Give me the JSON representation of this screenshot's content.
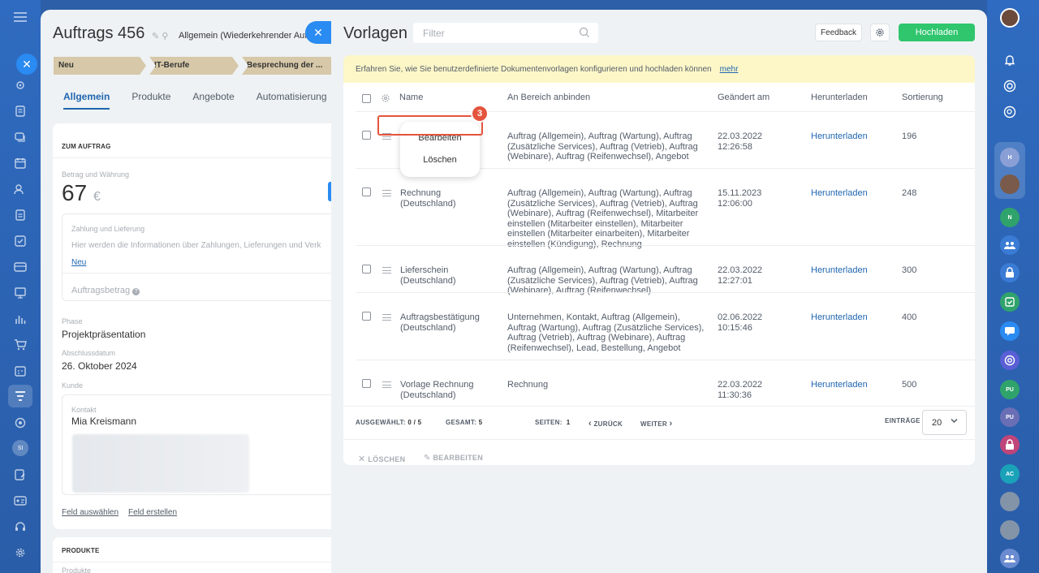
{
  "deal": {
    "title": "Auftrags 456",
    "subtitle": "Allgemein (Wiederkehrender Auftr",
    "stages": [
      "Neu",
      "IT-Berufe",
      "Besprechung der ..."
    ],
    "tabs": [
      "Allgemein",
      "Produkte",
      "Angebote",
      "Automatisierung"
    ],
    "section_title": "ZUM AUFTRAG",
    "amount_label": "Betrag und Währung",
    "amount_value": "67",
    "currency": "€",
    "payment_title": "Zahlung und Lieferung",
    "payment_text": "Hier werden die Informationen über Zahlungen, Lieferungen und Verk",
    "payment_link": "Neu",
    "order_amount_label": "Auftragsbetrag",
    "phase_label": "Phase",
    "phase_value": "Projektpräsentation",
    "close_date_label": "Abschlussdatum",
    "close_date_value": "26. Oktober 2024",
    "customer_label": "Kunde",
    "contact_label": "Kontakt",
    "contact_value": "Mia Kreismann",
    "select_field": "Feld auswählen",
    "create_field": "Feld erstellen",
    "products_title": "PRODUKTE",
    "products_label": "Produkte"
  },
  "slider": {
    "title": "Vorlagen",
    "filter_placeholder": "Filter",
    "feedback": "Feedback",
    "upload": "Hochladen",
    "info_text": "Erfahren Sie, wie Sie benutzerdefinierte Dokumentenvorlagen konfigurieren und hochladen können",
    "info_link": "mehr",
    "columns": {
      "name": "Name",
      "area": "An Bereich anbinden",
      "changed": "Geändert am",
      "download": "Herunterladen",
      "sort": "Sortierung"
    },
    "rows": [
      {
        "name": "",
        "area": "Auftrag (Allgemein), Auftrag (Wartung), Auftrag (Zusätzliche Services), Auftrag (Vetrieb), Auftrag (Webinare), Auftrag (Reifenwechsel), Angebot",
        "changed_date": "22.03.2022",
        "changed_time": "12:26:58",
        "download": "Herunterladen",
        "sort": "196"
      },
      {
        "name": "Rechnung (Deutschland)",
        "area": "Auftrag (Allgemein), Auftrag (Wartung), Auftrag (Zusätzliche Services), Auftrag (Vetrieb), Auftrag (Webinare), Auftrag (Reifenwechsel), Mitarbeiter einstellen (Mitarbeiter einstellen), Mitarbeiter einstellen (Mitarbeiter einarbeiten), Mitarbeiter einstellen (Kündigung), Rechnung",
        "changed_date": "15.11.2023",
        "changed_time": "12:06:00",
        "download": "Herunterladen",
        "sort": "248"
      },
      {
        "name": "Lieferschein (Deutschland)",
        "area": "Auftrag (Allgemein), Auftrag (Wartung), Auftrag (Zusätzliche Services), Auftrag (Vetrieb), Auftrag (Webinare), Auftrag (Reifenwechsel)",
        "changed_date": "22.03.2022",
        "changed_time": "12:27:01",
        "download": "Herunterladen",
        "sort": "300"
      },
      {
        "name": "Auftragsbestätigung (Deutschland)",
        "area": "Unternehmen, Kontakt, Auftrag (Allgemein), Auftrag (Wartung), Auftrag (Zusätzliche Services), Auftrag (Vetrieb), Auftrag (Webinare), Auftrag (Reifenwechsel), Lead, Bestellung, Angebot",
        "changed_date": "02.06.2022",
        "changed_time": "10:15:46",
        "download": "Herunterladen",
        "sort": "400"
      },
      {
        "name": "Vorlage Rechnung (Deutschland)",
        "area": "Rechnung",
        "changed_date": "22.03.2022",
        "changed_time": "11:30:36",
        "download": "Herunterladen",
        "sort": "500"
      }
    ],
    "context_menu": {
      "edit": "Bearbeiten",
      "delete": "Löschen",
      "badge": "3"
    },
    "footer": {
      "selected_label": "AUSGEWÄHLT:",
      "selected_value": "0 / 5",
      "total_label": "GESAMT:",
      "total_value": "5",
      "pages_label": "SEITEN:",
      "pages_value": "1",
      "prev": "ZURÜCK",
      "next": "WEITER",
      "entries_label": "EINTRÄGE",
      "entries_value": "20"
    },
    "actions": {
      "delete": "LÖSCHEN",
      "edit": "BEARBEITEN"
    }
  },
  "right_bar": {
    "badges": [
      "H",
      "N",
      "PU",
      "PU",
      "AC"
    ]
  },
  "left_bar": {
    "badge": "SI"
  },
  "colors": {
    "accent": "#2066b0",
    "upload_green": "#2fc66e",
    "highlight_red": "#e5543d",
    "info_yellow": "#fdf7c8"
  }
}
